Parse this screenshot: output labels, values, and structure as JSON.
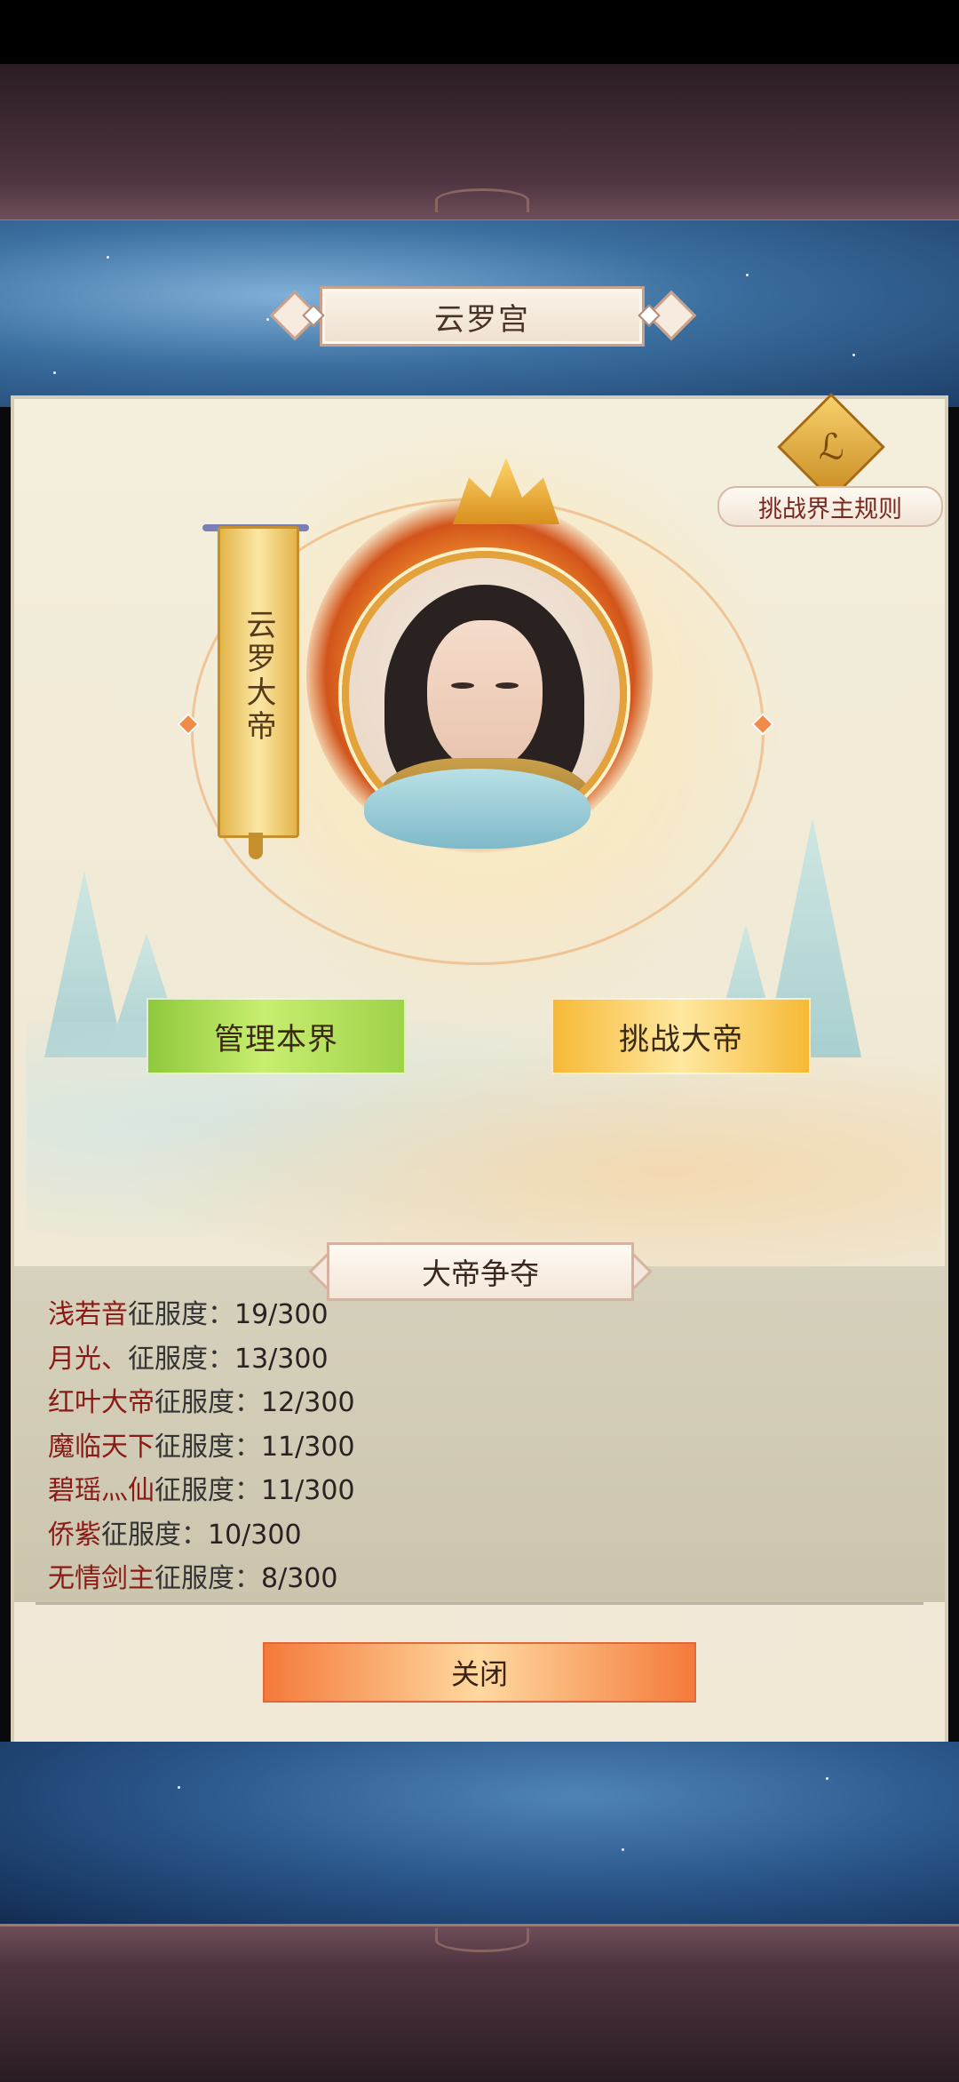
{
  "palace_title": "云罗宫",
  "rules_label": "挑战界主规则",
  "rules_icon": "scroll-emblem-icon",
  "ruler_banner": "云罗大帝",
  "buttons": {
    "manage": "管理本界",
    "challenge": "挑战大帝",
    "close": "关闭"
  },
  "contest": {
    "title": "大帝争夺",
    "separator": "征服度：",
    "entries": [
      {
        "name": "浅若音",
        "score": "19/300"
      },
      {
        "name": "月光、",
        "score": "13/300"
      },
      {
        "name": "红叶大帝",
        "score": "12/300"
      },
      {
        "name": "魔临天下",
        "score": "11/300"
      },
      {
        "name": "碧瑶灬仙",
        "score": "11/300"
      },
      {
        "name": "侨紫",
        "score": "10/300"
      },
      {
        "name": "无情剑主",
        "score": "8/300"
      }
    ]
  },
  "colors": {
    "name_text": "#8a1a16",
    "manage_button": "#9fd24a",
    "challenge_button": "#f6b936",
    "close_button": "#f47a3a"
  }
}
